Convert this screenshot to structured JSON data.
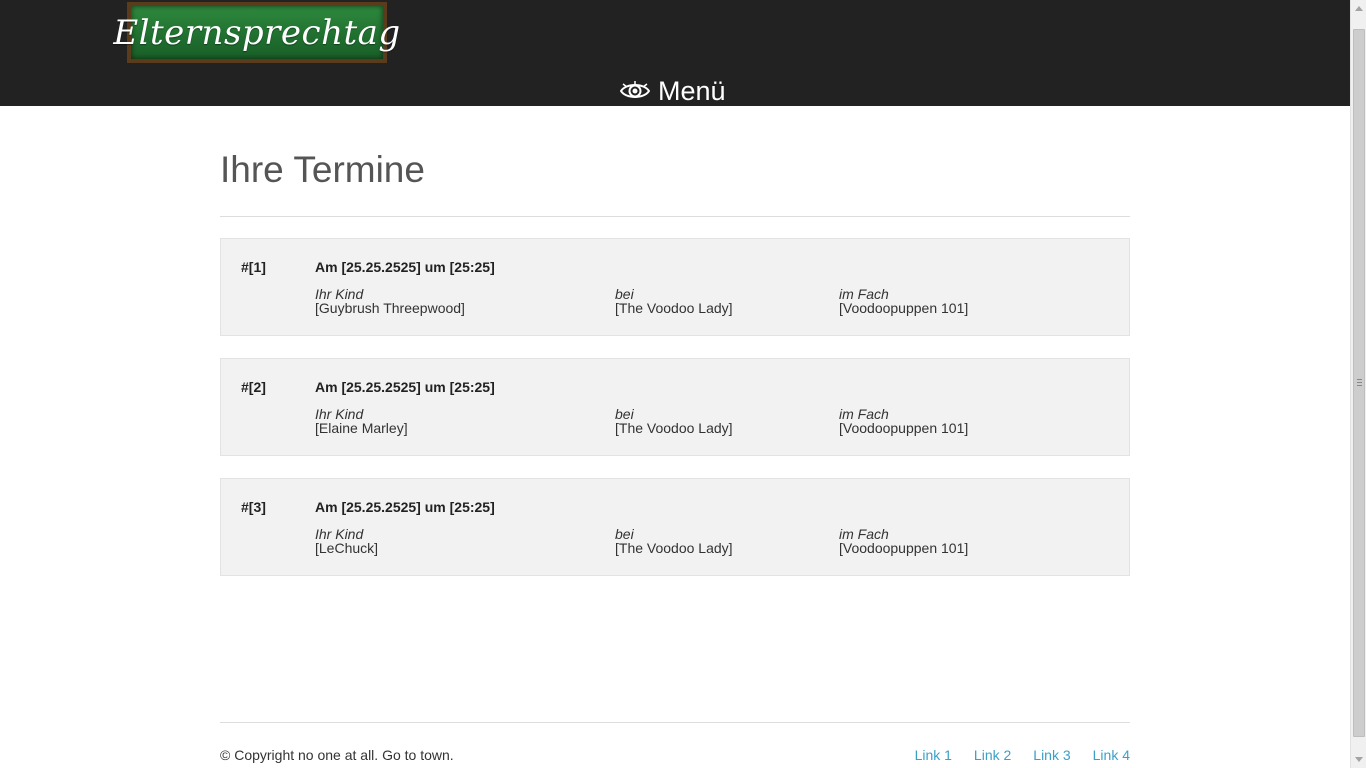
{
  "header": {
    "logo_text": "Elternsprechtag",
    "menu_label": "Menü",
    "menu_icon": "eye-icon"
  },
  "main": {
    "title": "Ihre Termine",
    "appointments": [
      {
        "number": "#[1]",
        "when": "Am [25.25.2525] um [25:25]",
        "child_label": "Ihr Kind",
        "child": "[Guybrush Threepwood]",
        "teacher_label": "bei",
        "teacher": "[The Voodoo Lady]",
        "subject_label": "im Fach",
        "subject": "[Voodoopuppen 101]"
      },
      {
        "number": "#[2]",
        "when": "Am [25.25.2525] um [25:25]",
        "child_label": "Ihr Kind",
        "child": "[Elaine Marley]",
        "teacher_label": "bei",
        "teacher": "[The Voodoo Lady]",
        "subject_label": "im Fach",
        "subject": "[Voodoopuppen 101]"
      },
      {
        "number": "#[3]",
        "when": "Am [25.25.2525] um [25:25]",
        "child_label": "Ihr Kind",
        "child": "[LeChuck]",
        "teacher_label": "bei",
        "teacher": "[The Voodoo Lady]",
        "subject_label": "im Fach",
        "subject": "[Voodoopuppen 101]"
      }
    ]
  },
  "footer": {
    "copyright": "© Copyright no one at all. Go to town.",
    "links": [
      "Link 1",
      "Link 2",
      "Link 3",
      "Link 4"
    ]
  },
  "colors": {
    "header_bg": "#222222",
    "link": "#3aa0c8",
    "card_bg": "#f2f2f2"
  }
}
